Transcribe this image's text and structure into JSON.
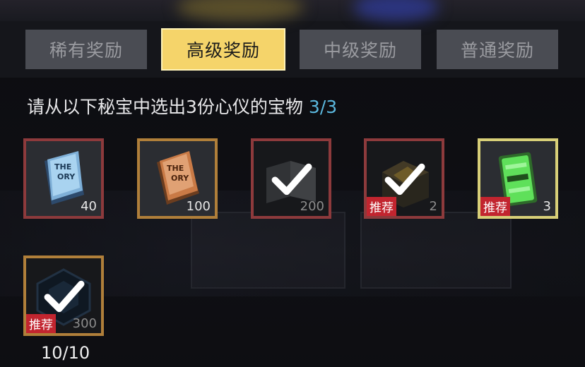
{
  "tabs": [
    {
      "label": "稀有奖励",
      "active": false
    },
    {
      "label": "高级奖励",
      "active": true
    },
    {
      "label": "中级奖励",
      "active": false
    },
    {
      "label": "普通奖励",
      "active": false
    }
  ],
  "prompt": {
    "text": "请从以下秘宝中选出3份心仪的宝物",
    "count": "3/3"
  },
  "items": [
    {
      "qty": "40",
      "checked": false,
      "tag": ""
    },
    {
      "qty": "100",
      "checked": false,
      "tag": ""
    },
    {
      "qty": "200",
      "checked": true,
      "tag": ""
    },
    {
      "qty": "2",
      "checked": true,
      "tag": "推荐"
    },
    {
      "qty": "3",
      "checked": false,
      "tag": "推荐"
    },
    {
      "qty": "300",
      "checked": true,
      "tag": "推荐"
    }
  ],
  "progress": "10/10",
  "colors": {
    "active_tab": "#f5d46a",
    "tag_red": "#c2252f",
    "count_blue": "#5bb8de"
  }
}
